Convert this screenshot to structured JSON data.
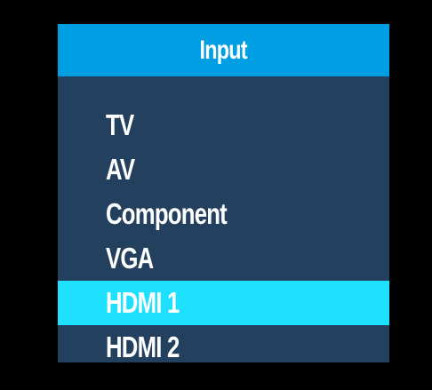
{
  "menu": {
    "title": "Input",
    "items": [
      {
        "label": "TV",
        "selected": false
      },
      {
        "label": "AV",
        "selected": false
      },
      {
        "label": "Component",
        "selected": false
      },
      {
        "label": "VGA",
        "selected": false
      },
      {
        "label": "HDMI 1",
        "selected": true
      },
      {
        "label": "HDMI 2",
        "selected": false
      }
    ]
  },
  "colors": {
    "background": "#000000",
    "panel": "#23415f",
    "header": "#009fe4",
    "selected_highlight": "#1ee1ff",
    "text": "#ffffff"
  }
}
